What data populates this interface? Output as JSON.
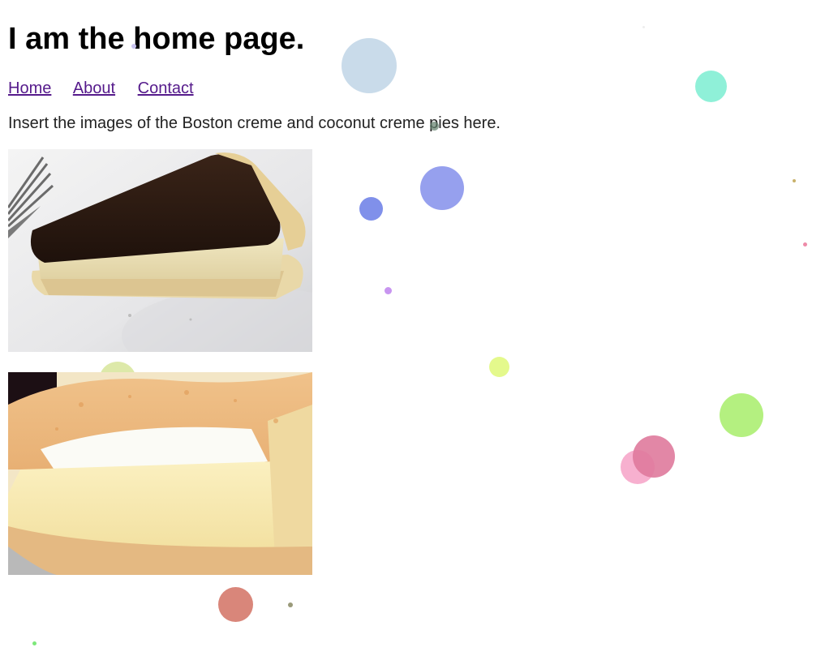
{
  "page": {
    "title": "I am the home page.",
    "nav": [
      {
        "label": "Home"
      },
      {
        "label": "About"
      },
      {
        "label": "Contact"
      }
    ],
    "intro": "Insert the images of the Boston creme and coconut creme pies here."
  },
  "images": [
    {
      "name": "boston-creme-pie-image"
    },
    {
      "name": "coconut-creme-pie-image"
    }
  ]
}
